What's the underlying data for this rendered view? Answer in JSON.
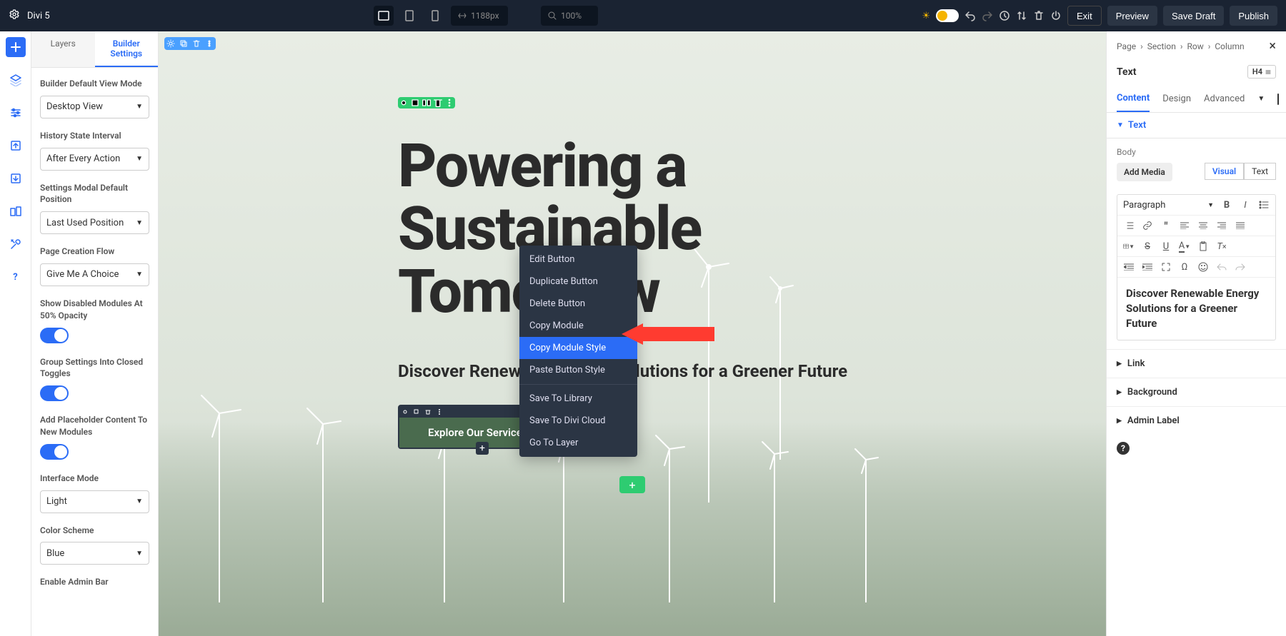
{
  "topbar": {
    "title": "Divi 5",
    "width_value": "1188px",
    "zoom_value": "100%",
    "exit": "Exit",
    "preview": "Preview",
    "save_draft": "Save Draft",
    "publish": "Publish"
  },
  "left_tabs": {
    "layers": "Layers",
    "settings": "Builder Settings"
  },
  "left_panel": {
    "s0_label": "Builder Default View Mode",
    "s0_value": "Desktop View",
    "s1_label": "History State Interval",
    "s1_value": "After Every Action",
    "s2_label": "Settings Modal Default Position",
    "s2_value": "Last Used Position",
    "s3_label": "Page Creation Flow",
    "s3_value": "Give Me A Choice",
    "t0_label": "Show Disabled Modules At 50% Opacity",
    "t1_label": "Group Settings Into Closed Toggles",
    "t2_label": "Add Placeholder Content To New Modules",
    "s4_label": "Interface Mode",
    "s4_value": "Light",
    "s5_label": "Color Scheme",
    "s5_value": "Blue",
    "t3_label": "Enable Admin Bar"
  },
  "hero": {
    "h1_a": "Powering a",
    "h1_b": "Sustainable",
    "h1_c": "Tomorrow",
    "subtitle": "Discover Renewable Energy Solutions for a Greener Future",
    "cta": "Explore Our Services"
  },
  "context_menu": {
    "i0": "Edit Button",
    "i1": "Duplicate Button",
    "i2": "Delete Button",
    "i3": "Copy Module",
    "i4": "Copy Module Style",
    "i5": "Paste Button Style",
    "i6": "Save To Library",
    "i7": "Save To Divi Cloud",
    "i8": "Go To Layer"
  },
  "right_panel": {
    "crumb0": "Page",
    "crumb1": "Section",
    "crumb2": "Row",
    "crumb3": "Column",
    "title": "Text",
    "heading_badge": "H4",
    "tab_content": "Content",
    "tab_design": "Design",
    "tab_advanced": "Advanced",
    "toggle_text": "Text",
    "body_label": "Body",
    "add_media": "Add Media",
    "visual": "Visual",
    "text_tab": "Text",
    "paragraph": "Paragraph",
    "editor_content": "Discover Renewable Energy Solutions for a Greener Future",
    "link": "Link",
    "background": "Background",
    "admin_label": "Admin Label"
  }
}
